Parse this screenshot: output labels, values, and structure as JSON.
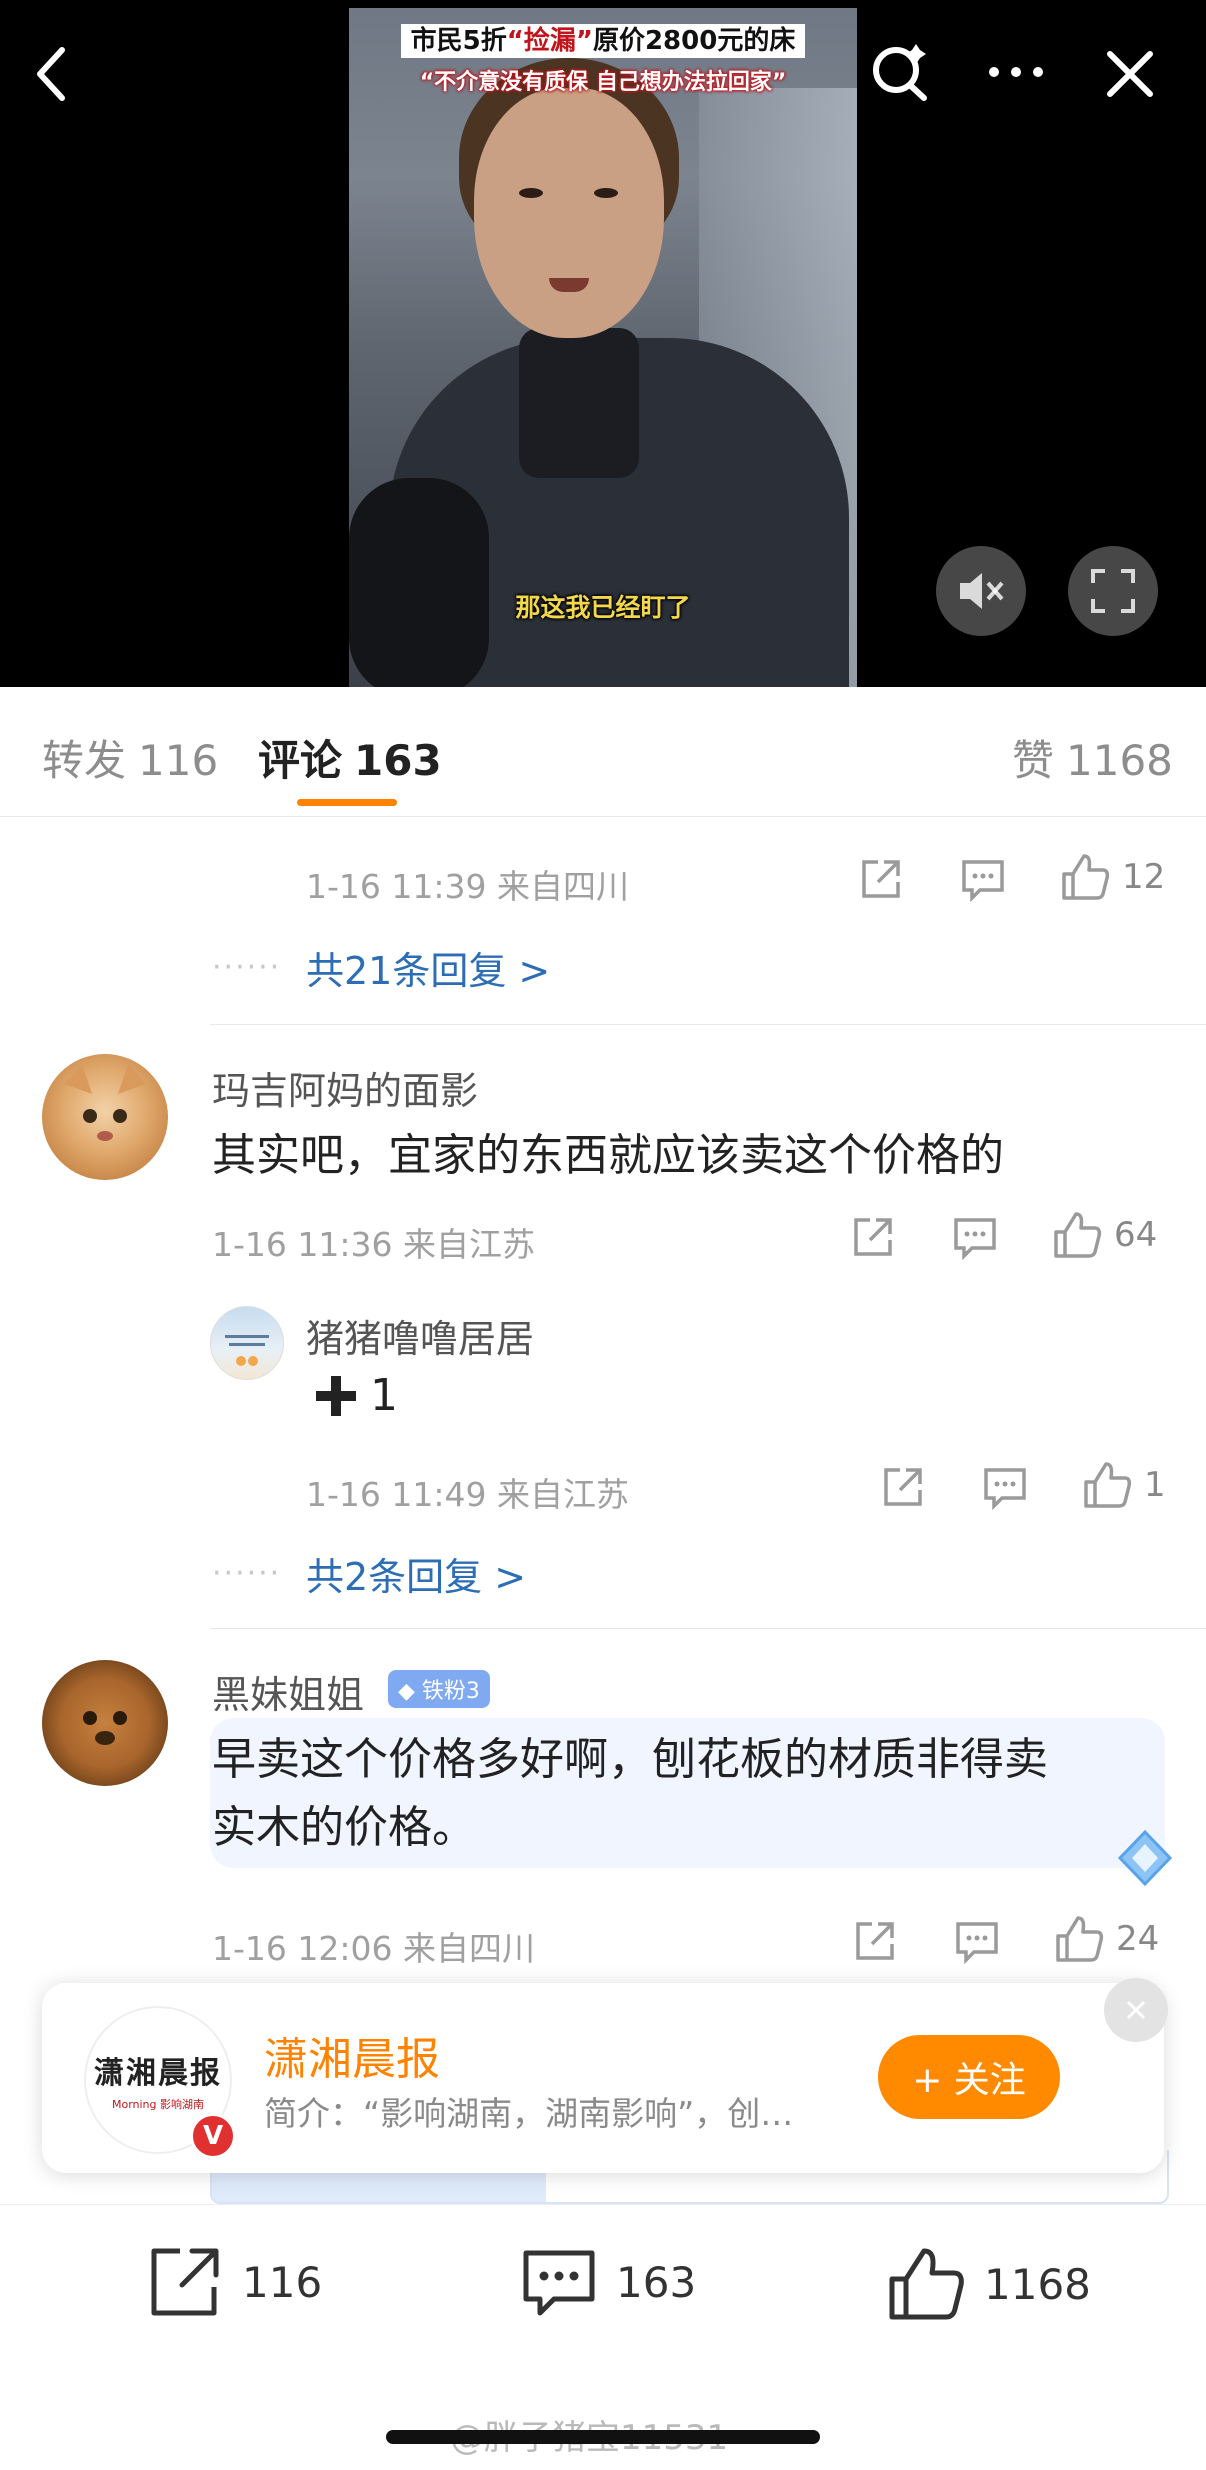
{
  "video": {
    "title_part1": "市民5折",
    "title_highlight": "“捡漏”",
    "title_part2": "原价2800元的床",
    "subtitle_line": "“不介意没有质保 自己想办法拉回家”",
    "caption": "那这我已经盯了"
  },
  "tabs": [
    {
      "label": "转发",
      "count": "116"
    },
    {
      "label": "评论",
      "count": "163"
    },
    {
      "label": "赞",
      "count": "1168"
    }
  ],
  "reply_footer": {
    "meta": "1-16 11:39  来自四川",
    "likes": "12",
    "more_dots": "······",
    "more_text": "共21条回复 >"
  },
  "comments": [
    {
      "name": "玛吉阿妈的面影",
      "text": "其实吧，宜家的东西就应该卖这个价格的",
      "meta": "1-16 11:36  来自江苏",
      "likes": "64",
      "reply": {
        "name": "猪猪噜噜居居",
        "text": "1",
        "meta": "1-16 11:49  来自江苏",
        "likes": "1"
      },
      "more_dots": "······",
      "more_text": "共2条回复 >"
    },
    {
      "name": "黑妹姐姐",
      "badge": "铁粉3",
      "text_line1": "早卖这个价格多好啊，刨花板的材质非得卖",
      "text_line2": "实木的价格。",
      "meta": "1-16 12:06  来自四川",
      "likes": "24"
    }
  ],
  "follow_card": {
    "name": "潇湘晨报",
    "desc": "简介：“影响湖南，湖南影响”，创…",
    "follow_label": "+ 关注",
    "logo_text": "潇湘晨报",
    "logo_sub": "Morning 影响湖南",
    "verified": "V"
  },
  "bottom_bar": {
    "repost": "116",
    "comment": "163",
    "like": "1168"
  },
  "watermark": "@胖子猪宝11531",
  "colors": {
    "accent": "#ff8200",
    "link": "#2c6db5",
    "verified": "#e0302f"
  }
}
